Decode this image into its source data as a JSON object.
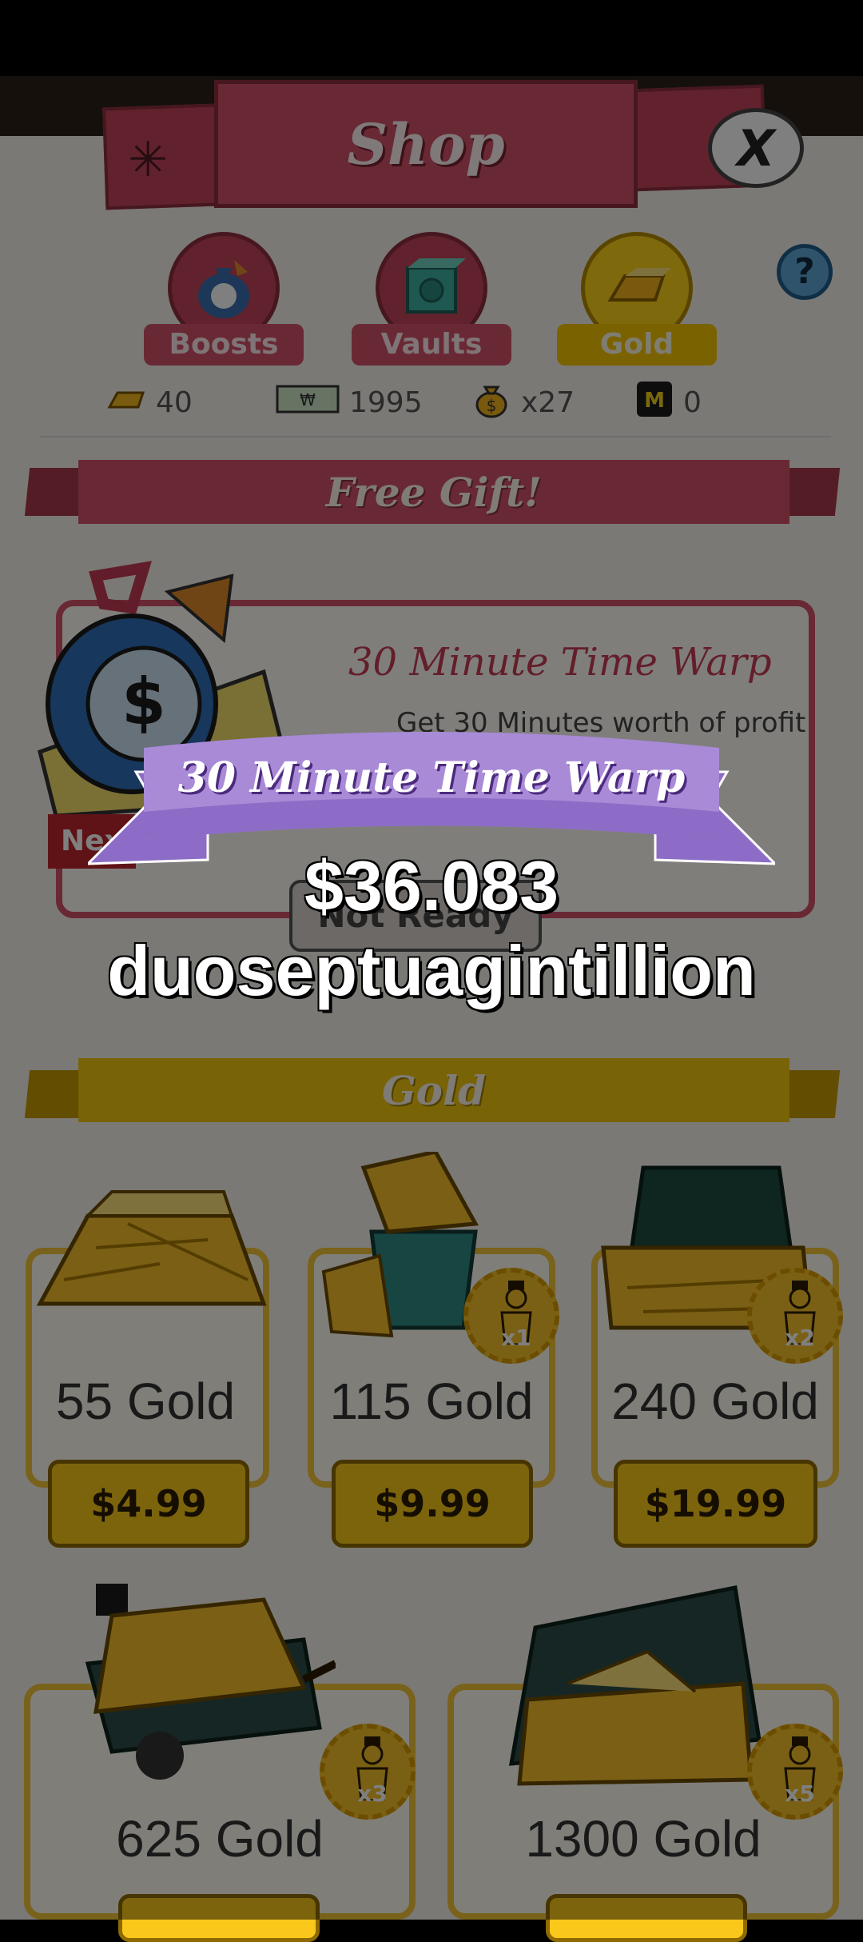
{
  "header": {
    "title": "Shop",
    "close_label": "X",
    "help_label": "?"
  },
  "tabs": [
    {
      "label": "Boosts",
      "icon": "boosts-bag-icon"
    },
    {
      "label": "Vaults",
      "icon": "vault-icon"
    },
    {
      "label": "Gold",
      "icon": "gold-icon",
      "selected": true
    }
  ],
  "currencies": [
    {
      "icon": "gold-bar-icon",
      "value": "40"
    },
    {
      "icon": "cash-icon",
      "value": "1995"
    },
    {
      "icon": "money-bag-icon",
      "value": "x27"
    },
    {
      "icon": "mega-bucks-icon",
      "value": "0"
    }
  ],
  "free_gift": {
    "section_title": "Free Gift!",
    "title": "30 Minute Time Warp",
    "description": "Get 30 Minutes worth of profit",
    "description_tail": "n",
    "next_label": "Next",
    "button_label": "Not Ready"
  },
  "gold_section": {
    "title": "Gold",
    "items": [
      {
        "label": "55 Gold",
        "price": "$4.99",
        "badge": ""
      },
      {
        "label": "115 Gold",
        "price": "$9.99",
        "badge": "x1"
      },
      {
        "label": "240 Gold",
        "price": "$19.99",
        "badge": "x2"
      },
      {
        "label": "625 Gold",
        "price": "",
        "badge": "x3"
      },
      {
        "label": "1300 Gold",
        "price": "",
        "badge": "x5"
      }
    ]
  },
  "popup": {
    "ribbon_title": "30 Minute Time Warp",
    "amount_line1": "$36.083",
    "amount_line2": "duoseptuagintillion"
  },
  "colors": {
    "shop_red": "#d35268",
    "gold": "#f9c81b",
    "ribbon_purple": "#a98ad6"
  }
}
